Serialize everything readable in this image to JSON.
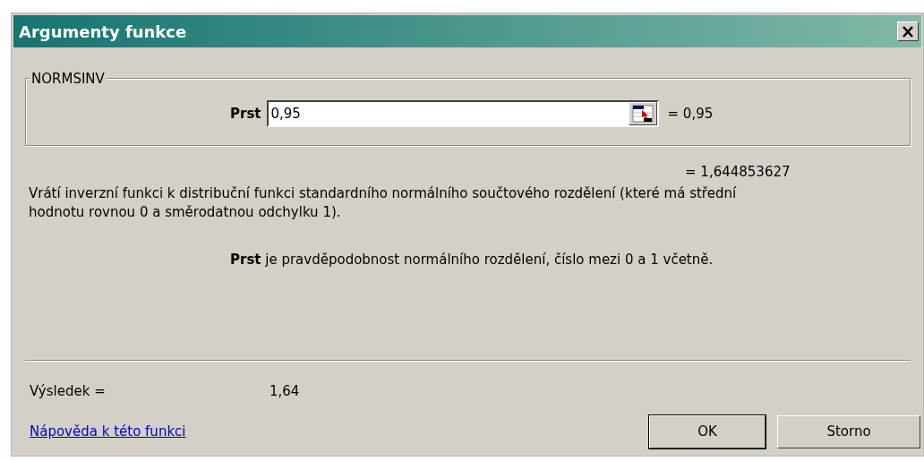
{
  "window": {
    "title": "Argumenty funkce"
  },
  "function_group": {
    "label": "NORMSINV",
    "arguments": [
      {
        "label": "Prst",
        "value": "0,95",
        "result": "= 0,95"
      }
    ]
  },
  "formula_result": "= 1,644853627",
  "description": "Vrátí inverzní funkci k distribuční funkci standardního normálního součtového rozdělení (které má střední hodnotu rovnou 0 a směrodatnou odchylku 1).",
  "argument_help": "**Prst** je pravděpodobnost normálního rozdělení, číslo mezi 0 a 1 včetně.",
  "result": {
    "label": "Výsledek =",
    "value": "1,64"
  },
  "help_link": "Nápověda k této funkci",
  "buttons": [
    {
      "label": "OK",
      "default": true
    },
    {
      "label": "Storno",
      "default": false
    }
  ]
}
